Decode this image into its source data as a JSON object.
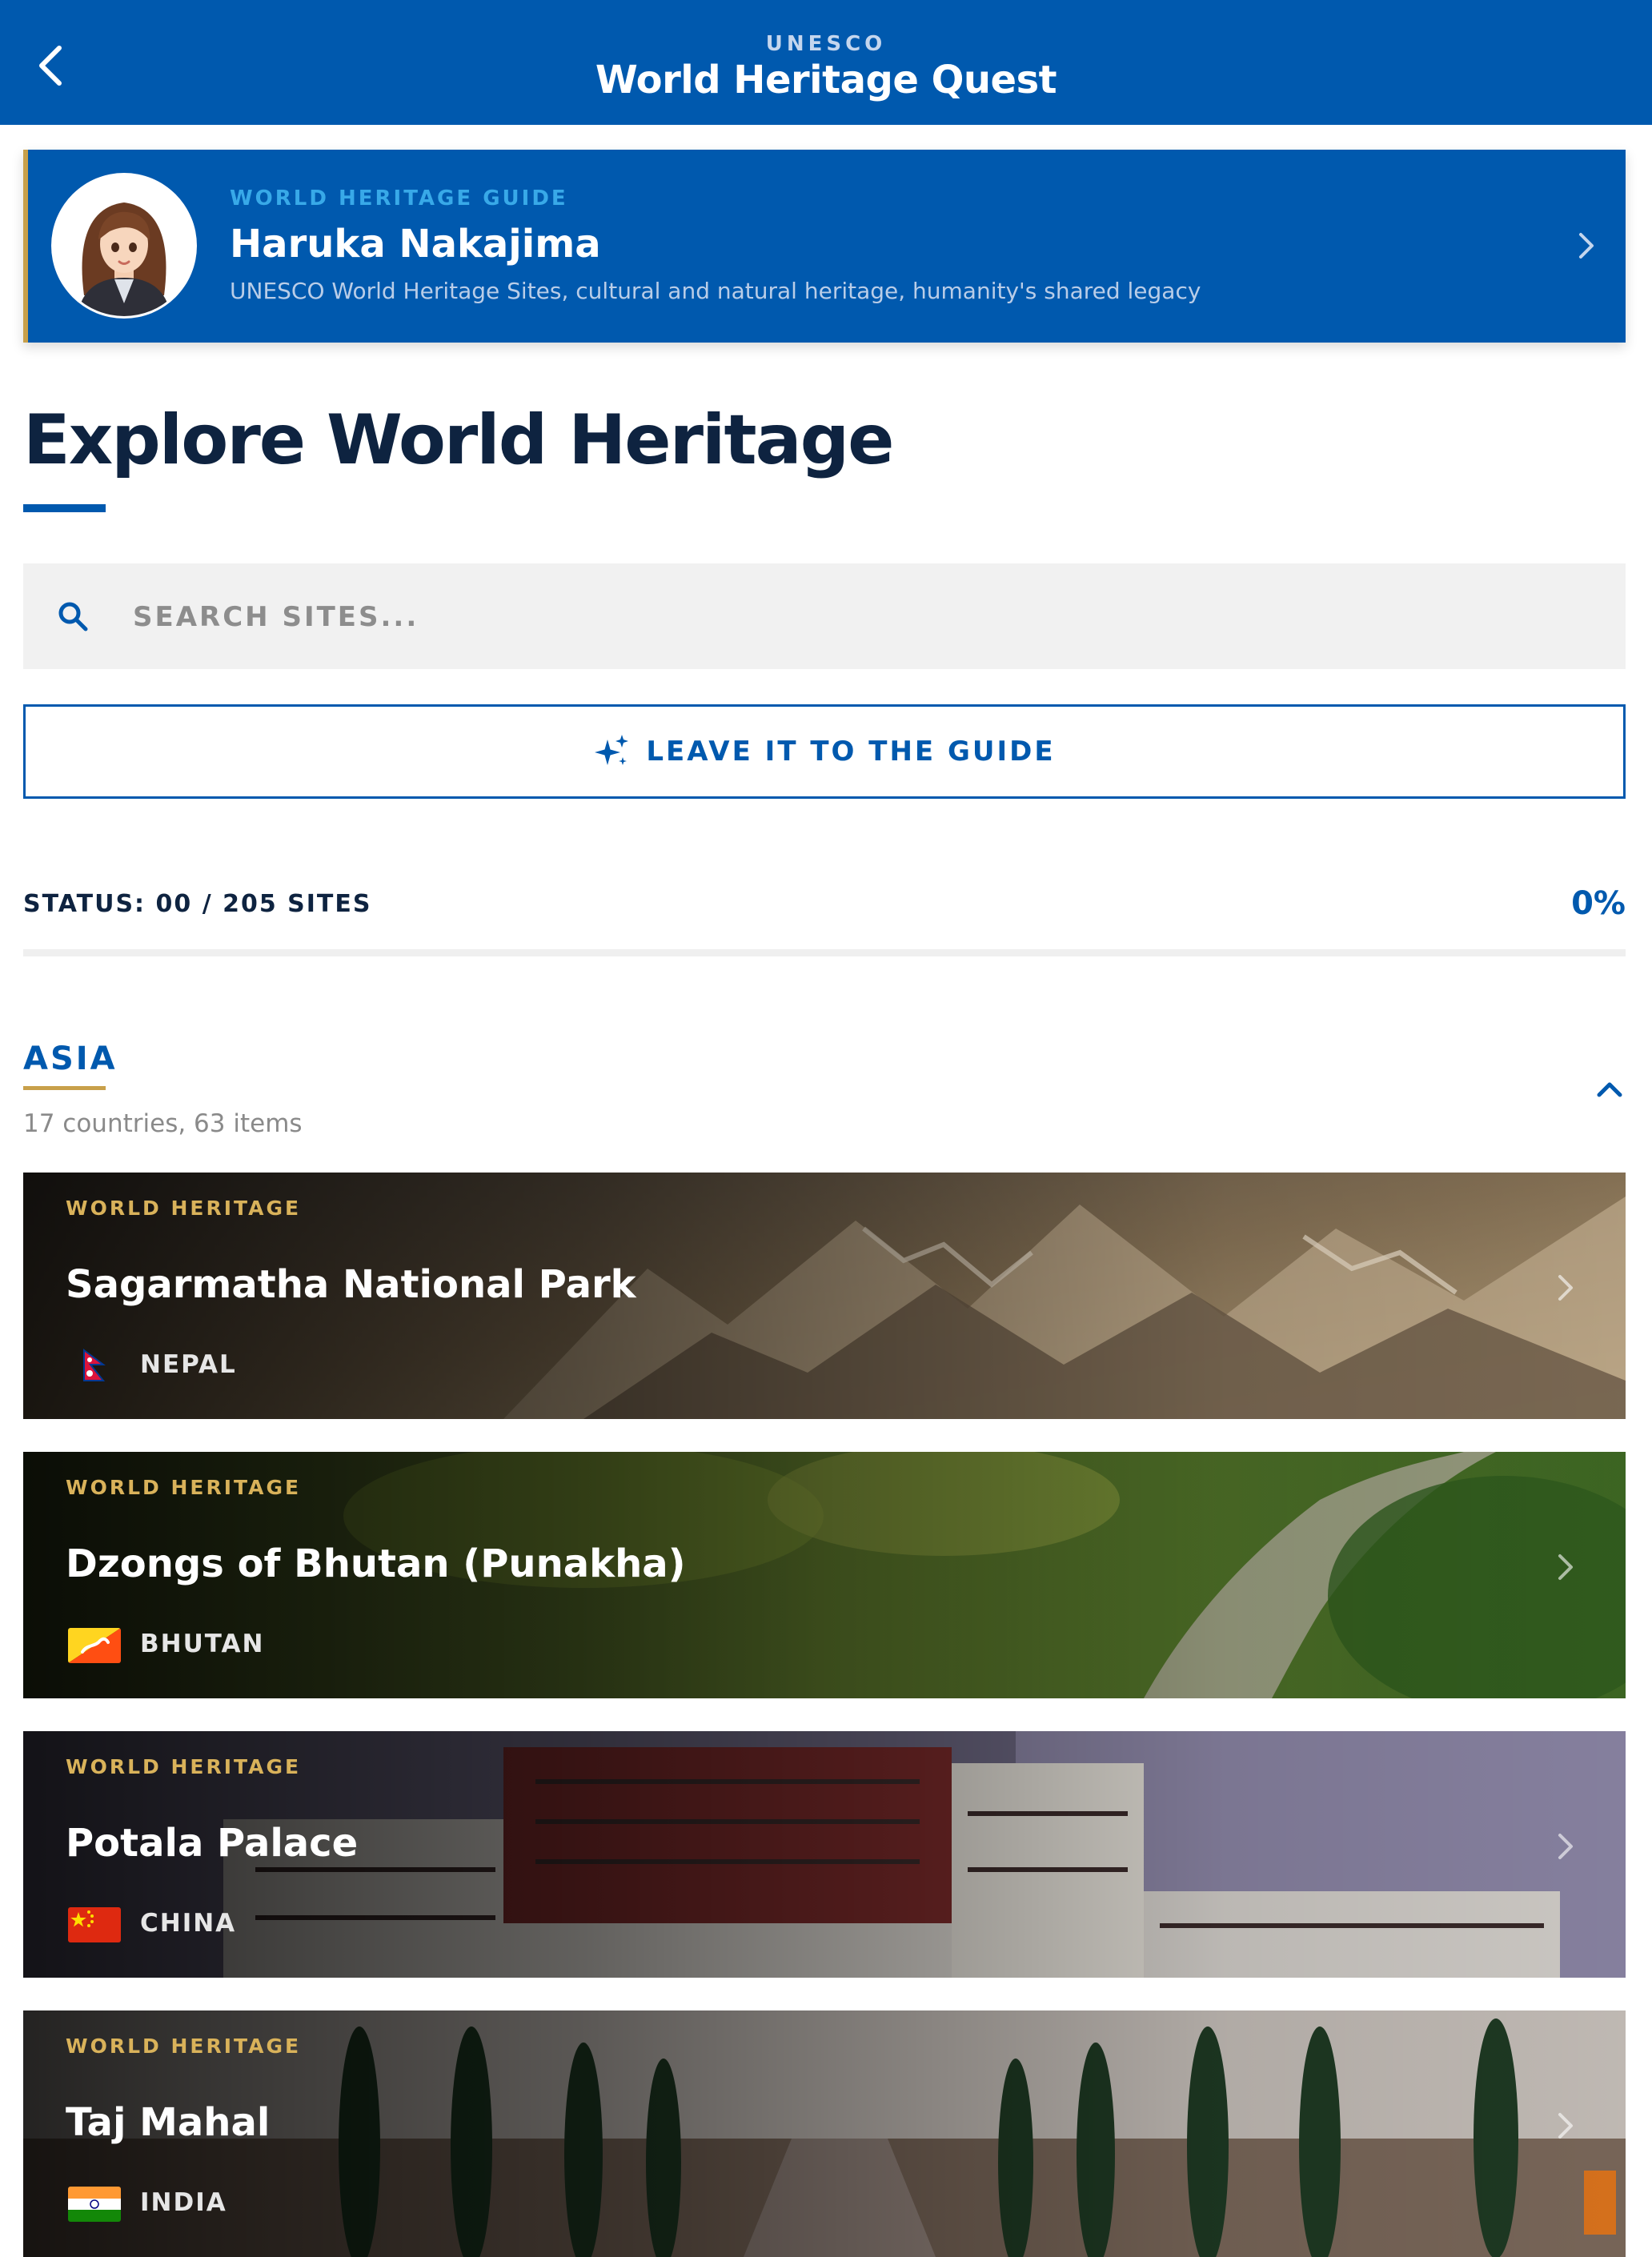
{
  "header": {
    "subtitle": "UNESCO",
    "title": "World Heritage Quest",
    "back_icon": "chevron-left-icon"
  },
  "guide": {
    "kicker": "WORLD HERITAGE GUIDE",
    "name": "Haruka Nakajima",
    "description": "UNESCO World Heritage Sites, cultural and natural heritage, humanity's shared legacy"
  },
  "main": {
    "title": "Explore World Heritage",
    "search": {
      "placeholder": "SEARCH SITES...",
      "value": ""
    },
    "leave_button": "LEAVE IT TO THE GUIDE",
    "status": {
      "label": "STATUS: 00 / 205 SITES",
      "percent": "0%",
      "progress_fraction": 0
    }
  },
  "region": {
    "name": "ASIA",
    "meta": "17 countries, 63 items",
    "sites": [
      {
        "kicker": "WORLD HERITAGE",
        "name": "Sagarmatha National Park",
        "country": "NEPAL"
      },
      {
        "kicker": "WORLD HERITAGE",
        "name": "Dzongs of Bhutan (Punakha)",
        "country": "BHUTAN"
      },
      {
        "kicker": "WORLD HERITAGE",
        "name": "Potala Palace",
        "country": "CHINA"
      },
      {
        "kicker": "WORLD HERITAGE",
        "name": "Taj Mahal",
        "country": "INDIA"
      }
    ]
  },
  "colors": {
    "primary": "#0059ae",
    "accent_gold": "#c8a04a",
    "kicker_cyan": "#38a9e8",
    "text_dark": "#0e2340"
  }
}
